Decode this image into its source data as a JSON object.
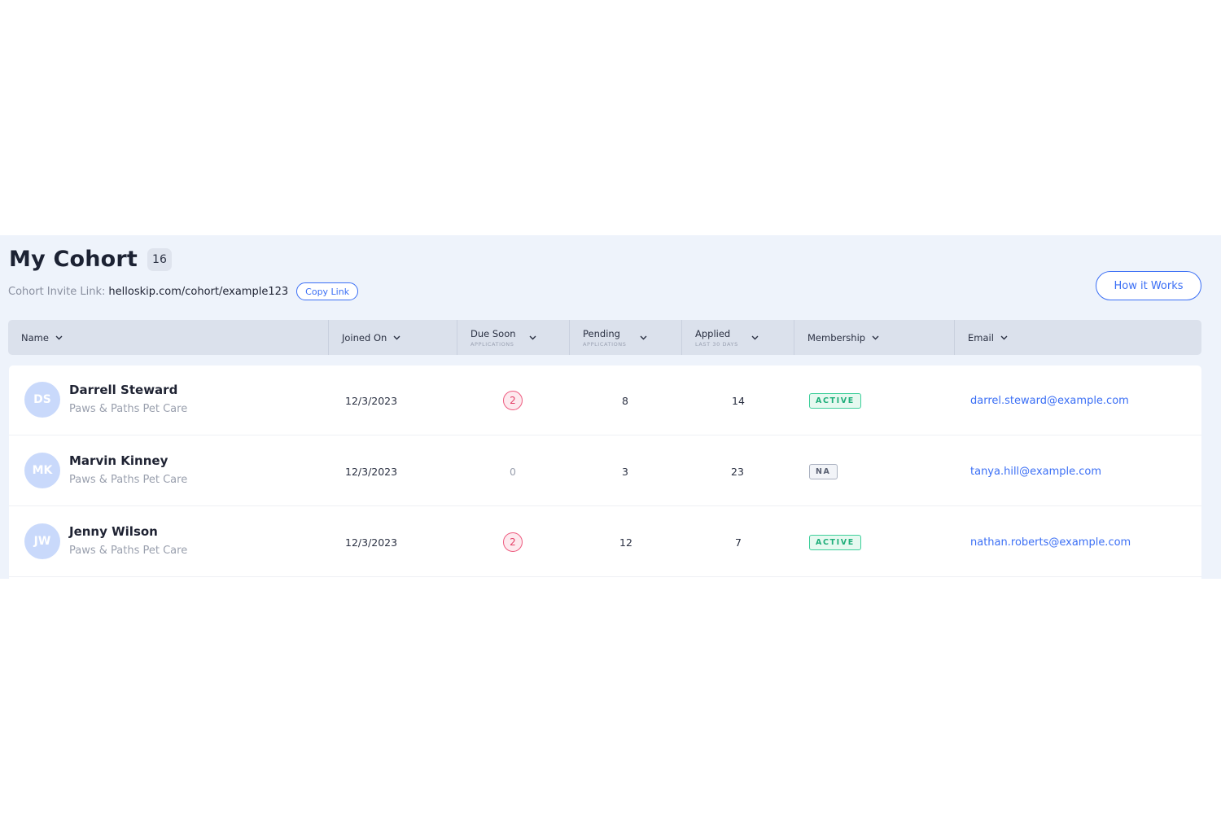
{
  "header": {
    "title": "My Cohort",
    "count": "16",
    "invite_label": "Cohort Invite Link:",
    "invite_url": "helloskip.com/cohort/example123",
    "copy_label": "Copy Link",
    "how_label": "How it Works"
  },
  "columns": [
    {
      "label": "Name",
      "sub": ""
    },
    {
      "label": "Joined On",
      "sub": ""
    },
    {
      "label": "Due Soon",
      "sub": "APPLICATIONS"
    },
    {
      "label": "Pending",
      "sub": "APPLICATIONS"
    },
    {
      "label": "Applied",
      "sub": "LAST 30 DAYS"
    },
    {
      "label": "Membership",
      "sub": ""
    },
    {
      "label": "Email",
      "sub": ""
    }
  ],
  "rows": [
    {
      "initials": "DS",
      "name": "Darrell Steward",
      "company": "Paws & Paths Pet Care",
      "joined": "12/3/2023",
      "due": "2",
      "pending": "8",
      "applied": "14",
      "membership": "ACTIVE",
      "email": "darrel.steward@example.com"
    },
    {
      "initials": "MK",
      "name": "Marvin Kinney",
      "company": "Paws & Paths Pet Care",
      "joined": "12/3/2023",
      "due": "0",
      "pending": "3",
      "applied": "23",
      "membership": "NA",
      "email": "tanya.hill@example.com"
    },
    {
      "initials": "JW",
      "name": "Jenny Wilson",
      "company": "Paws & Paths Pet Care",
      "joined": "12/3/2023",
      "due": "2",
      "pending": "12",
      "applied": "7",
      "membership": "ACTIVE",
      "email": "nathan.roberts@example.com"
    }
  ],
  "colors": {
    "accent": "#3b6ff5",
    "due_badge": "#ee5b7f",
    "active": "#3ccf9a",
    "panel_bg": "#eef3fb"
  },
  "icons": {
    "sort": "chevron-down-icon"
  }
}
